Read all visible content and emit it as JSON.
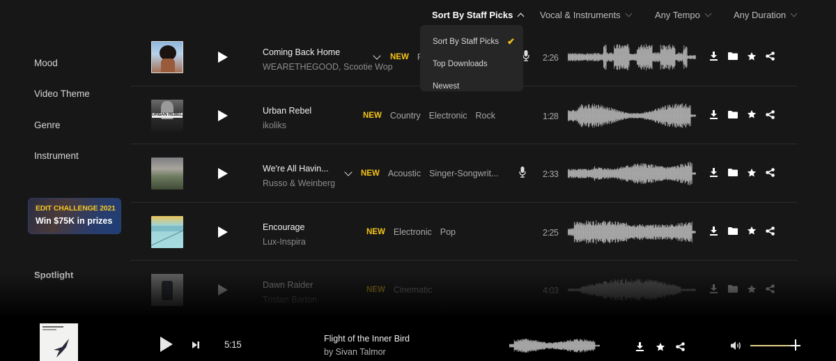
{
  "filters": [
    {
      "label": "Sort By Staff Picks",
      "active": true
    },
    {
      "label": "Vocal & Instruments",
      "active": false
    },
    {
      "label": "Any Tempo",
      "active": false
    },
    {
      "label": "Any Duration",
      "active": false
    }
  ],
  "sort_dropdown": {
    "options": [
      "Sort By Staff Picks",
      "Top Downloads",
      "Newest"
    ],
    "selected": "Sort By Staff Picks"
  },
  "sidebar": {
    "items": [
      {
        "label": "Mood"
      },
      {
        "label": "Video Theme"
      },
      {
        "label": "Genre"
      },
      {
        "label": "Instrument"
      }
    ],
    "banner": {
      "title": "EDIT CHALLENGE 2021",
      "subtitle": "Win $75K in prizes"
    },
    "spotlight": "Spotlight"
  },
  "colors": {
    "accent": "#f5c518",
    "background": "#171717",
    "player_bg": "#000000",
    "volume_fill": "#e8d48a"
  },
  "tracks": [
    {
      "title": "Coming Back Home",
      "artist": "WEARETHEGOOD, Scootie Wop",
      "badge": "NEW",
      "tags": [
        "P"
      ],
      "has_vocals": true,
      "expandable": true,
      "duration": "2:26",
      "cover": "afro-portrait"
    },
    {
      "title": "Urban Rebel",
      "artist": "ikoliks",
      "badge": "NEW",
      "tags": [
        "Country",
        "Electronic",
        "Rock"
      ],
      "has_vocals": false,
      "expandable": false,
      "duration": "1:28",
      "cover": "urban-rebel"
    },
    {
      "title": "We're All Havin...",
      "artist": "Russo & Weinberg",
      "badge": "NEW",
      "tags": [
        "Acoustic",
        "Singer-Songwrit..."
      ],
      "has_vocals": true,
      "expandable": true,
      "duration": "2:33",
      "cover": "landscape"
    },
    {
      "title": "Encourage",
      "artist": "Lux-Inspira",
      "badge": "NEW",
      "tags": [
        "Electronic",
        "Pop"
      ],
      "has_vocals": false,
      "expandable": false,
      "duration": "2:25",
      "cover": "teal-abstract"
    },
    {
      "title": "Dawn Raider",
      "artist": "Tristan Barton",
      "badge": "NEW",
      "tags": [
        "Cinematic"
      ],
      "has_vocals": false,
      "expandable": false,
      "duration": "4:03",
      "cover": "grey-object"
    }
  ],
  "track_actions": [
    "download-icon",
    "folder-icon",
    "star-icon",
    "share-icon"
  ],
  "player": {
    "title": "Flight of the Inner Bird",
    "artist": "by Sivan Talmor",
    "time": "5:15",
    "volume_percent": 90,
    "actions": [
      "download-icon",
      "star-icon",
      "share-icon"
    ]
  }
}
